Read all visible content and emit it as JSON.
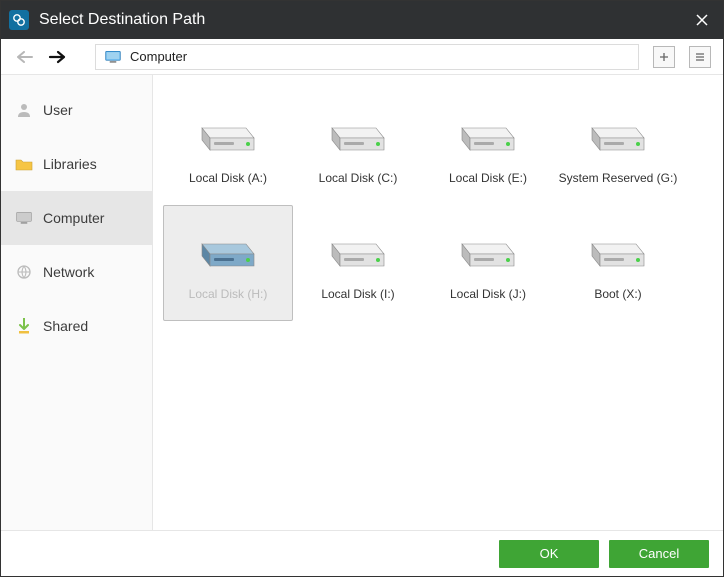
{
  "title": "Select Destination Path",
  "location": "Computer",
  "sidebar": [
    {
      "id": "user",
      "label": "User",
      "active": false
    },
    {
      "id": "libraries",
      "label": "Libraries",
      "active": false
    },
    {
      "id": "computer",
      "label": "Computer",
      "active": true
    },
    {
      "id": "network",
      "label": "Network",
      "active": false
    },
    {
      "id": "shared",
      "label": "Shared",
      "active": false
    }
  ],
  "disks": [
    {
      "label": "Local Disk (A:)",
      "selected": false
    },
    {
      "label": "Local Disk (C:)",
      "selected": false
    },
    {
      "label": "Local Disk (E:)",
      "selected": false
    },
    {
      "label": "System Reserved (G:)",
      "selected": false
    },
    {
      "label": "Local Disk (H:)",
      "selected": true
    },
    {
      "label": "Local Disk (I:)",
      "selected": false
    },
    {
      "label": "Local Disk (J:)",
      "selected": false
    },
    {
      "label": "Boot (X:)",
      "selected": false
    }
  ],
  "buttons": {
    "ok": "OK",
    "cancel": "Cancel"
  },
  "colors": {
    "accent": "#3fa535",
    "titlebar": "#2f3133"
  }
}
